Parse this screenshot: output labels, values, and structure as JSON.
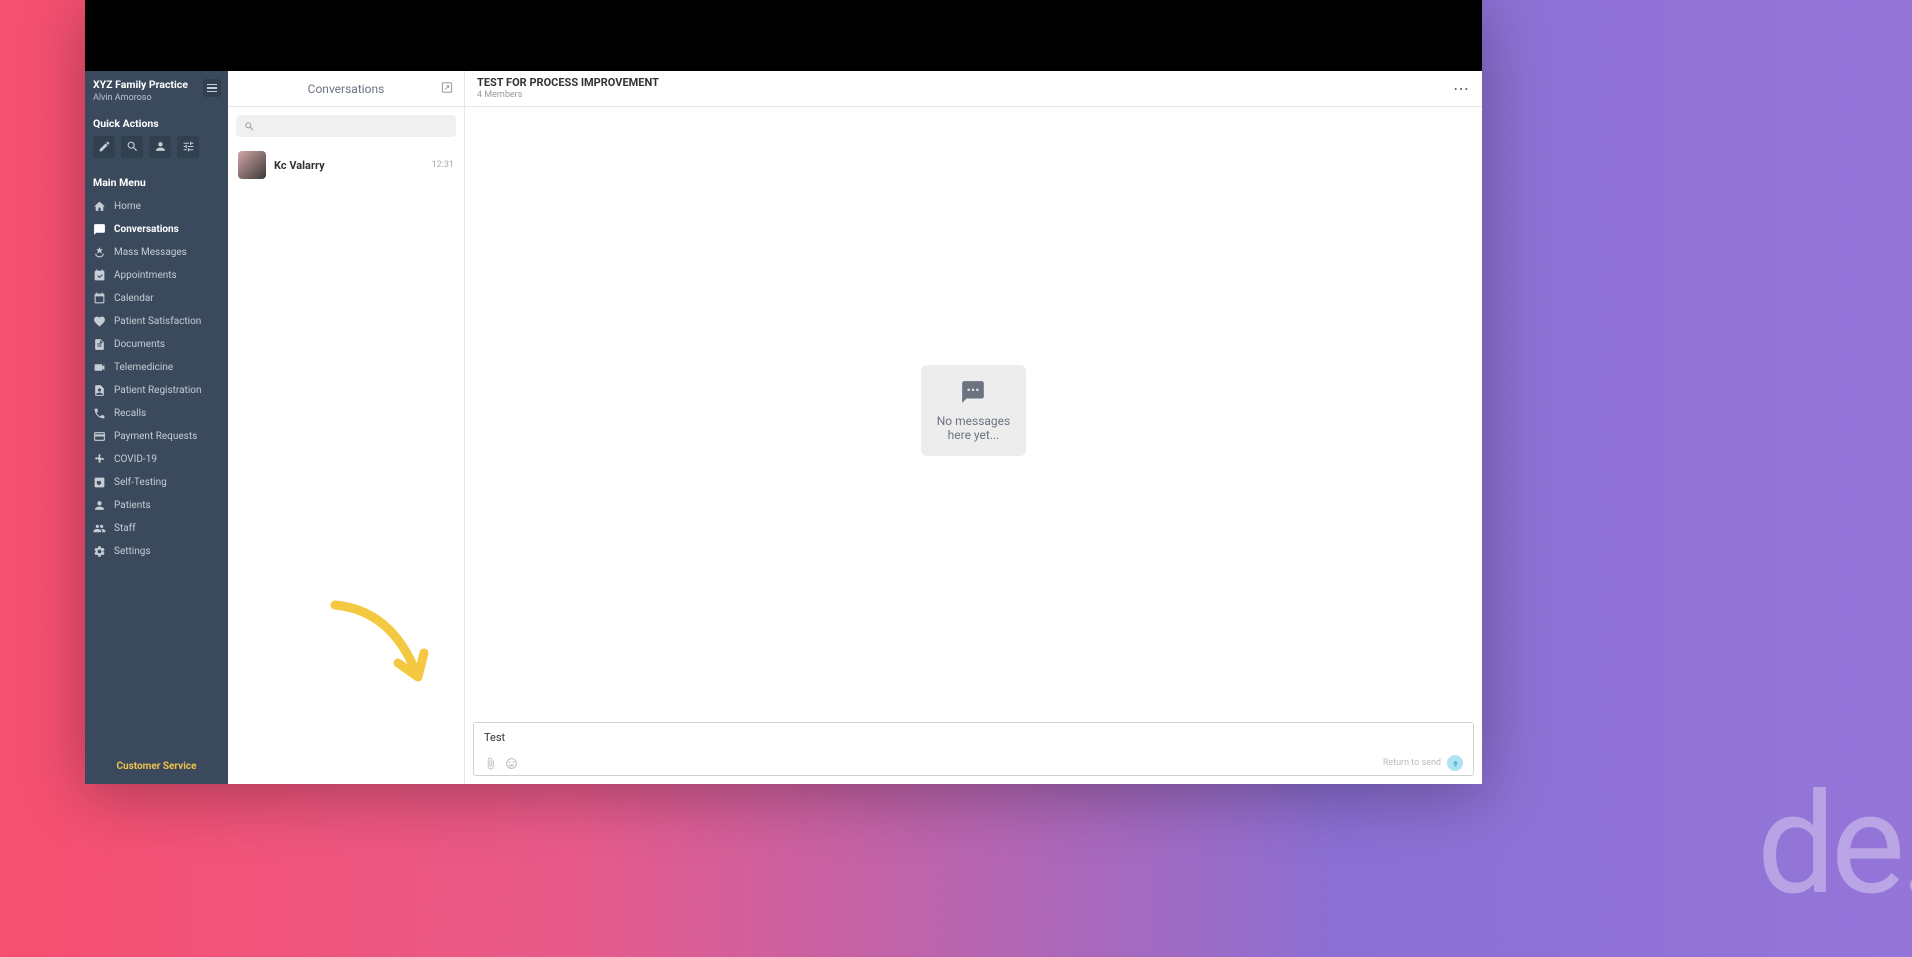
{
  "background_text": "de.",
  "sidebar": {
    "practice_name": "XYZ Family Practice",
    "user_name": "Alvin Amoroso",
    "quick_actions_title": "Quick Actions",
    "main_menu_title": "Main Menu",
    "items": [
      {
        "label": "Home",
        "icon": "home"
      },
      {
        "label": "Conversations",
        "icon": "chat",
        "active": true
      },
      {
        "label": "Mass Messages",
        "icon": "broadcast"
      },
      {
        "label": "Appointments",
        "icon": "appointments"
      },
      {
        "label": "Calendar",
        "icon": "calendar"
      },
      {
        "label": "Patient Satisfaction",
        "icon": "heart"
      },
      {
        "label": "Documents",
        "icon": "document"
      },
      {
        "label": "Telemedicine",
        "icon": "telemed"
      },
      {
        "label": "Patient Registration",
        "icon": "registration"
      },
      {
        "label": "Recalls",
        "icon": "recall"
      },
      {
        "label": "Payment Requests",
        "icon": "payment"
      },
      {
        "label": "COVID-19",
        "icon": "covid"
      },
      {
        "label": "Self-Testing",
        "icon": "selftest"
      },
      {
        "label": "Patients",
        "icon": "patients"
      },
      {
        "label": "Staff",
        "icon": "staff"
      },
      {
        "label": "Settings",
        "icon": "settings"
      }
    ],
    "customer_service": "Customer Service"
  },
  "conv_panel": {
    "title": "Conversations",
    "items": [
      {
        "name": "Kc Valarry",
        "time": "12:31"
      }
    ]
  },
  "chat": {
    "title": "TEST FOR PROCESS IMPROVEMENT",
    "members": "4 Members",
    "empty_line1": "No messages",
    "empty_line2": "here yet...",
    "composer_value": "Test",
    "return_label": "Return to send"
  }
}
